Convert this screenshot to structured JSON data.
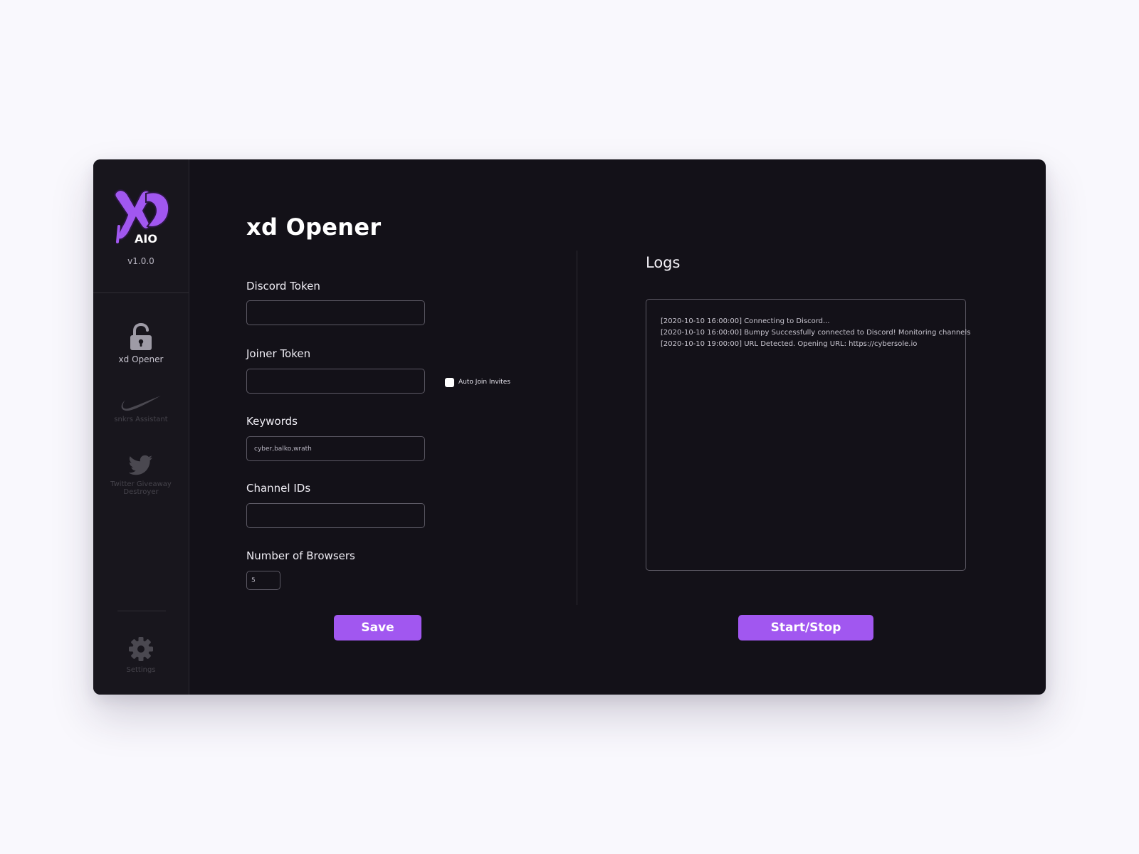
{
  "app": {
    "logo_text": "AIO",
    "version": "v1.0.0"
  },
  "sidebar": {
    "items": [
      {
        "label": "xd Opener",
        "icon": "unlock-icon",
        "active": true
      },
      {
        "label": "snkrs Assistant",
        "icon": "nike-swoosh-icon",
        "active": false
      },
      {
        "label": "Twitter Giveaway Destroyer",
        "icon": "twitter-bird-icon",
        "active": false
      }
    ],
    "settings": {
      "label": "Settings",
      "icon": "gear-icon"
    }
  },
  "main": {
    "title": "xd Opener",
    "fields": {
      "discord_token": {
        "label": "Discord Token",
        "value": ""
      },
      "joiner_token": {
        "label": "Joiner Token",
        "value": ""
      },
      "auto_join": {
        "label": "Auto Join Invites",
        "checked": false
      },
      "keywords": {
        "label": "Keywords",
        "value": "cyber,balko,wrath"
      },
      "channel_ids": {
        "label": "Channel IDs",
        "value": ""
      },
      "number_of_browsers": {
        "label": "Number of Browsers",
        "value": "5"
      }
    },
    "save_label": "Save"
  },
  "logs": {
    "title": "Logs",
    "lines": [
      "[2020-10-10 16:00:00] Connecting to Discord...",
      "[2020-10-10 16:00:00] Bumpy Successfully connected to Discord! Monitoring channels",
      "[2020-10-10 19:00:00] URL Detected. Opening URL: https://cybersole.io"
    ],
    "start_stop_label": "Start/Stop"
  },
  "colors": {
    "accent": "#a157f0",
    "window_bg": "#131118",
    "sidebar_bg": "#18161d",
    "page_bg": "#f9f8fd"
  }
}
